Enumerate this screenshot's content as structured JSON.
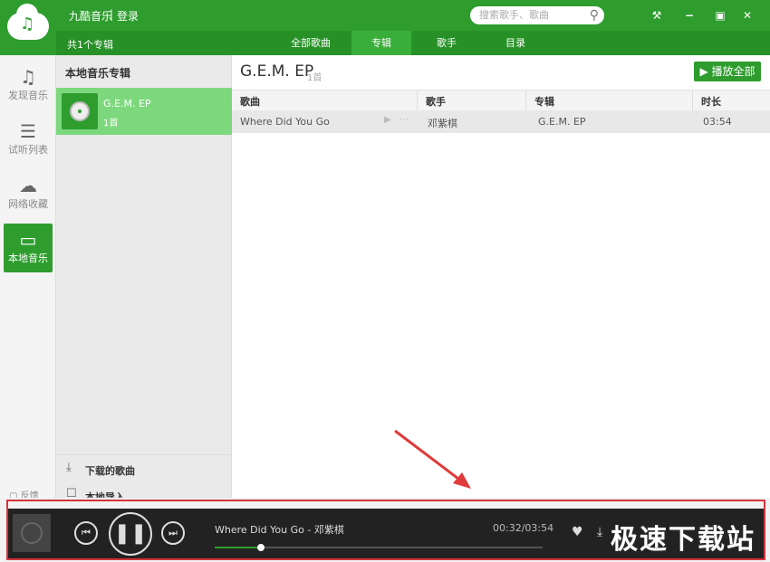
{
  "app": {
    "name": "九酷音乐",
    "login": "登录",
    "search_placeholder": "搜索歌手、歌曲"
  },
  "window_controls": [
    "wrench-icon",
    "minimize-icon",
    "restore-icon",
    "close-icon"
  ],
  "subbar": {
    "album_count": "共1个专辑",
    "tabs": [
      {
        "label": "全部歌曲",
        "active": false
      },
      {
        "label": "专辑",
        "active": true
      },
      {
        "label": "歌手",
        "active": false
      },
      {
        "label": "目录",
        "active": false
      }
    ]
  },
  "nav": {
    "items": [
      {
        "label": "发现音乐",
        "icon": "music-note-icon",
        "active": false
      },
      {
        "label": "试听列表",
        "icon": "list-icon",
        "active": false
      },
      {
        "label": "网络收藏",
        "icon": "cloud-icon",
        "active": false
      },
      {
        "label": "本地音乐",
        "icon": "monitor-icon",
        "active": true
      }
    ],
    "feedback": "反馈"
  },
  "album_panel": {
    "title": "本地音乐专辑",
    "albums": [
      {
        "name": "G.E.M. EP",
        "count": "1首"
      }
    ],
    "downloaded": "下载的歌曲",
    "import": "本地导入"
  },
  "main": {
    "title": "G.E.M. EP",
    "count": "1首",
    "play_all": "播放全部",
    "columns": [
      "歌曲",
      "歌手",
      "专辑",
      "时长"
    ],
    "rows": [
      {
        "song": "Where Did You Go",
        "artist": "邓紫棋",
        "album": "G.E.M. EP",
        "duration": "03:54"
      }
    ]
  },
  "player": {
    "now_playing": "Where Did You Go - 邓紫棋",
    "time": "00:32/03:54",
    "progress": 0.14,
    "state": "playing"
  },
  "watermark": "极速下载站",
  "colors": {
    "brand": "#2e9d2e",
    "highlight": "#d6333b"
  }
}
